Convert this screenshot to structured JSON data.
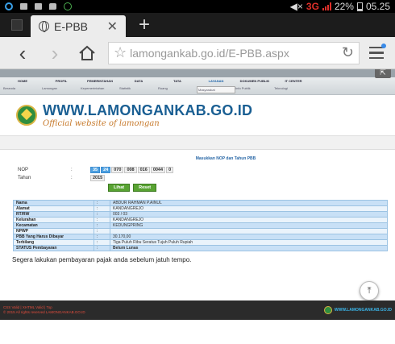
{
  "status_bar": {
    "network": "3G",
    "battery": "22%",
    "time": "05.25"
  },
  "browser": {
    "tab_title": "E-PBB",
    "url": "lamongankab.go.id/E-PBB.aspx"
  },
  "site": {
    "nav": [
      {
        "head": "HOME",
        "sub": "Beranda"
      },
      {
        "head": "PROFIL",
        "sub": "Lamongan"
      },
      {
        "head": "PEMERINTAHAN",
        "sub": "Kepemerintahan"
      },
      {
        "head": "DATA",
        "sub": "Statistik"
      },
      {
        "head": "TATA",
        "sub": "Ruang"
      },
      {
        "head": "LAYANAN",
        "sub": "Masyarakat"
      },
      {
        "head": "DOKUMEN PUBLIK",
        "sub": "Info Publik"
      },
      {
        "head": "IT CENTER",
        "sub": "Teknologi"
      }
    ],
    "brand_title": "WWW.LAMONGANKAB.GO.ID",
    "brand_sub": "Official website of lamongan"
  },
  "form": {
    "title": "Masukkan NOP dan Tahun PBB",
    "nop_label": "NOP",
    "nop_fields": [
      "35",
      "24",
      "070",
      "008",
      "016",
      "0044",
      "0"
    ],
    "tahun_label": "Tahun",
    "tahun_value": "2015",
    "colon": ":",
    "lihat_label": "Lihat",
    "reset_label": "Reset"
  },
  "result": [
    {
      "key": "Nama",
      "value": "ABDUR RAHMAN P.AINUL"
    },
    {
      "key": "Alamat",
      "value": "KANDANGREJO"
    },
    {
      "key": "RT/RW",
      "value": "003 / 03"
    },
    {
      "key": "Kelurahan",
      "value": "KANDANGREJO"
    },
    {
      "key": "Kecamatan",
      "value": "KEDUNGPRING"
    },
    {
      "key": "NPWP",
      "value": ""
    },
    {
      "key": "PBB Yang Harus Dibayar",
      "value": "30.170,00"
    },
    {
      "key": "Terbilang",
      "value": "Tiga Puluh Ribu Seratus Tujuh Puluh Rupiah"
    },
    {
      "key": "STATUS Pembayaran",
      "value": "Belum Lunas"
    }
  ],
  "note": "Segera lakukan pembayaran pajak anda sebelum jatuh tempo.",
  "footer": {
    "line1": "CSS Valid | XHTML Valid | Top",
    "line2": "© 2015 All rights reserved LAMONGANKAB.GO.ID",
    "brand": "WWW.LAMONGANKAB.GO.ID"
  },
  "colors": {
    "brand_blue": "#1a5f93",
    "accent_orange": "#c77a2c",
    "button_green": "#58a332",
    "table_blue": "#c8e0f6"
  }
}
